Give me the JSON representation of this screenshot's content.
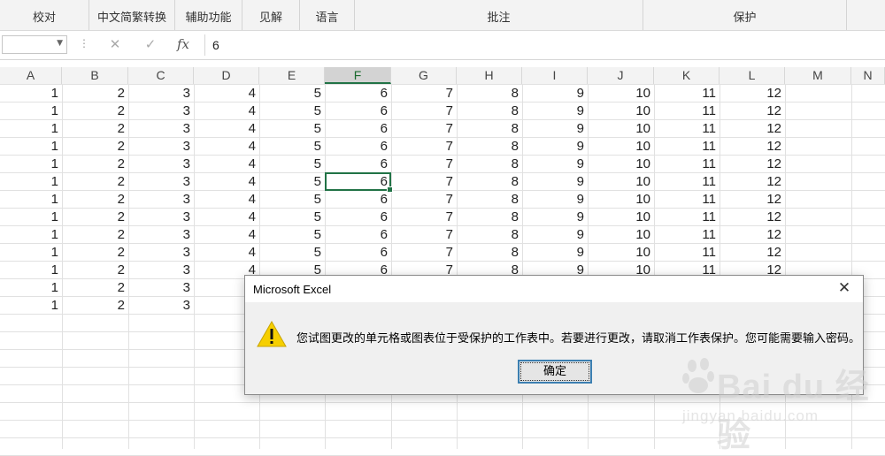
{
  "ribbon": {
    "groups": [
      {
        "label": "校对"
      },
      {
        "label": "中文简繁转换"
      },
      {
        "label": "辅助功能"
      },
      {
        "label": "见解"
      },
      {
        "label": "语言"
      },
      {
        "label": "批注"
      },
      {
        "label": "保护"
      }
    ]
  },
  "formula_bar": {
    "name_box": "",
    "cancel_icon": "✕",
    "enter_icon": "✓",
    "fx_label": "fx",
    "value": "6"
  },
  "sheet": {
    "columns": [
      "A",
      "B",
      "C",
      "D",
      "E",
      "F",
      "G",
      "H",
      "I",
      "J",
      "K",
      "L",
      "M",
      "N"
    ],
    "selected_column": "F",
    "active_cell": "F6",
    "full_row": [
      "1",
      "2",
      "3",
      "4",
      "5",
      "6",
      "7",
      "8",
      "9",
      "10",
      "11",
      "12"
    ],
    "partial_row": [
      "1",
      "2",
      "3"
    ],
    "full_rows_count": 11,
    "partial_rows_count": 2
  },
  "dialog": {
    "title": "Microsoft Excel",
    "message": "您试图更改的单元格或图表位于受保护的工作表中。若要进行更改，请取消工作表保护。您可能需要输入密码。",
    "ok_label": "确定",
    "close_icon": "✕",
    "icon": "warning-icon"
  },
  "watermark": {
    "text": "Bai du 经验",
    "sub": "jingyan.baidu.com"
  },
  "colors": {
    "excel_green": "#217346",
    "warning_yellow": "#f6cf00",
    "focus_blue": "#3c7fb1"
  }
}
